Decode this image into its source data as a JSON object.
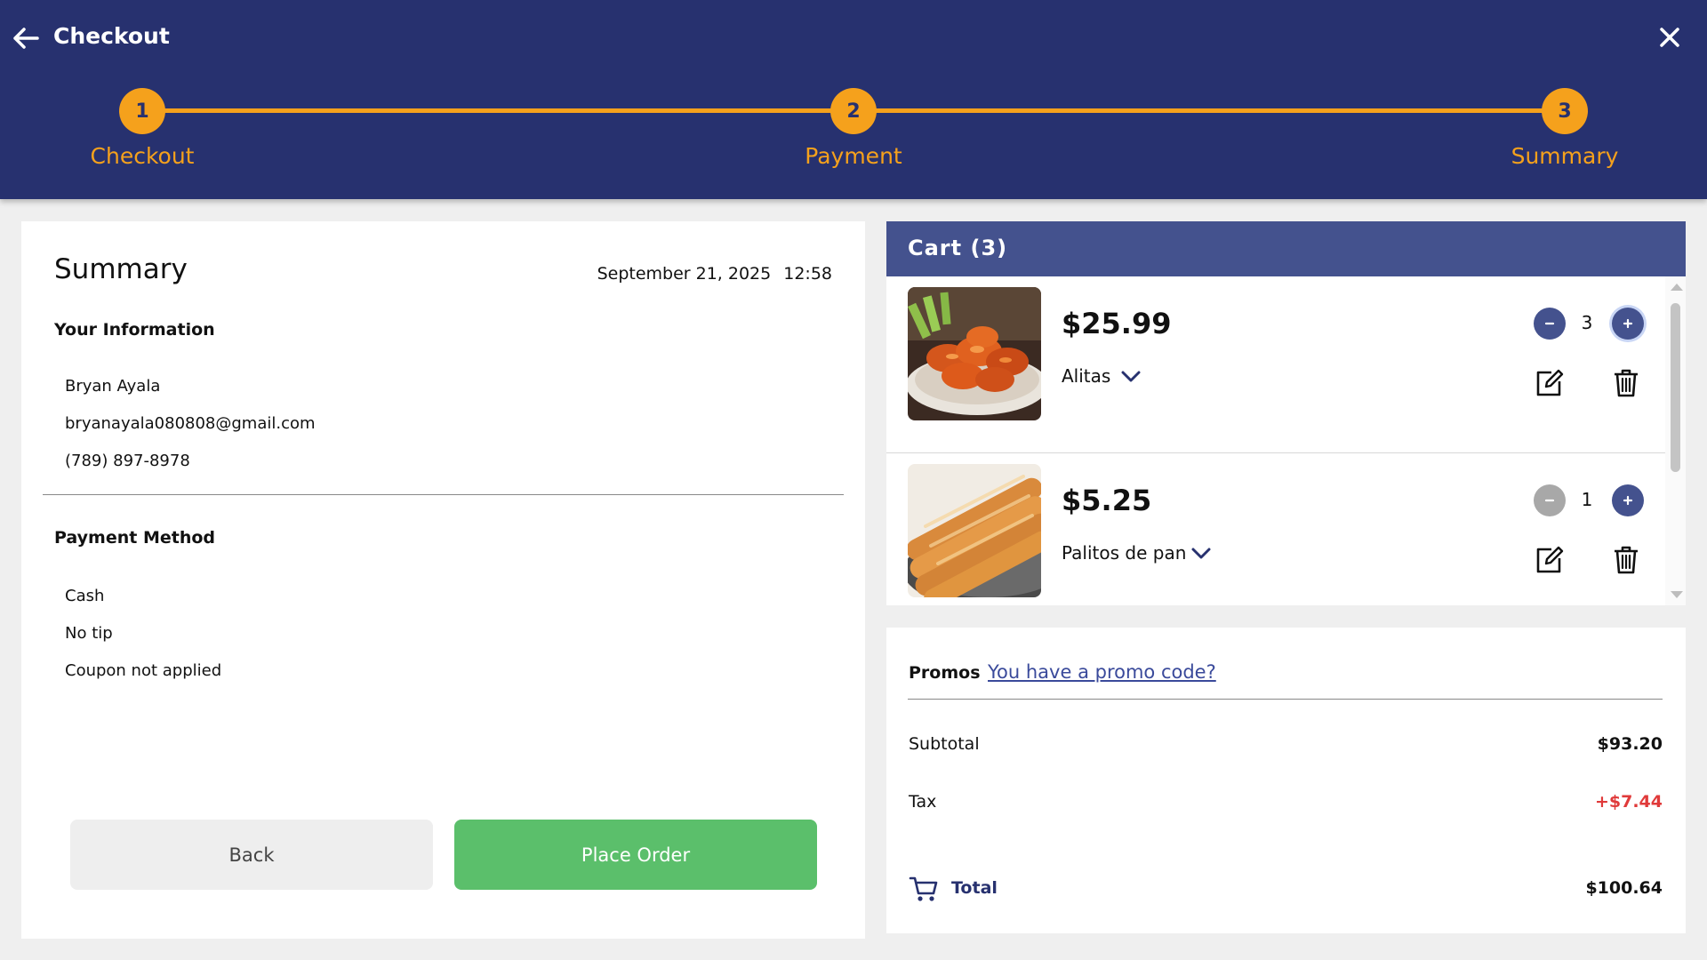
{
  "header": {
    "title": "Checkout",
    "steps": [
      {
        "number": "1",
        "label": "Checkout"
      },
      {
        "number": "2",
        "label": "Payment"
      },
      {
        "number": "3",
        "label": "Summary"
      }
    ]
  },
  "summary": {
    "title": "Summary",
    "date": "September 21, 2025",
    "time": "12:58",
    "your_information": {
      "title": "Your Information",
      "name": "Bryan Ayala",
      "email": "bryanayala080808@gmail.com",
      "phone": "(789) 897-8978"
    },
    "payment_method": {
      "title": "Payment Method",
      "method": "Cash",
      "tip": "No tip",
      "coupon": "Coupon not applied"
    },
    "buttons": {
      "back": "Back",
      "place_order": "Place Order"
    }
  },
  "cart": {
    "title": "Cart (3)",
    "items": [
      {
        "price": "$25.99",
        "name": "Alitas",
        "quantity": "3",
        "image": "chicken-wings-photo",
        "minus_enabled": true
      },
      {
        "price": "$5.25",
        "name": "Palitos de pan",
        "quantity": "1",
        "image": "breadsticks-photo",
        "minus_enabled": false
      }
    ]
  },
  "totals": {
    "promos_label": "Promos",
    "promo_link": "You have a promo code?",
    "subtotal_label": "Subtotal",
    "subtotal_value": "$93.20",
    "tax_label": "Tax",
    "tax_value": "+$7.44",
    "total_label": "Total",
    "total_value": "$100.64"
  },
  "colors": {
    "header_bg": "#27316f",
    "accent_orange": "#f5a11c",
    "cart_header_bg": "#44528e",
    "place_order_green": "#5bbf6b",
    "tax_red": "#e03a3a"
  }
}
